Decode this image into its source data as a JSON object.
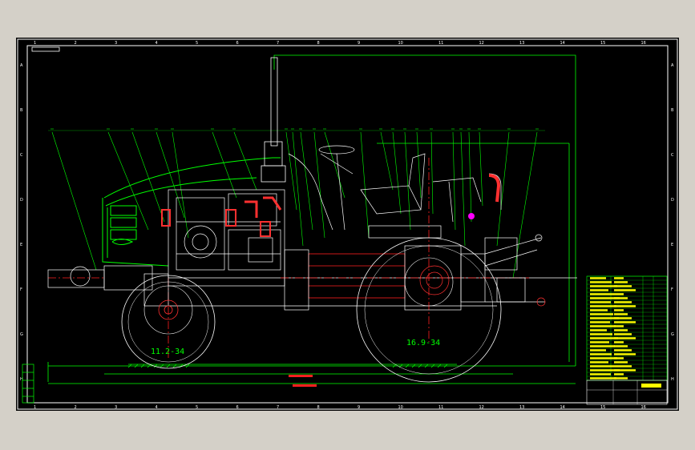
{
  "drawing": {
    "title": "tractor CAD assembly drawing",
    "colors": {
      "background": "#000000",
      "frame": "#ffffff",
      "outline": "#00ff00",
      "part_lines": "#ffffff",
      "red_hidden": "#ff0000",
      "accent_magenta": "#ff00ff",
      "title_yellow": "#ffff00"
    }
  },
  "tires": {
    "front_label": "11.2-34",
    "rear_label": "16.9-34"
  },
  "border": {
    "column_numbers": [
      "1",
      "2",
      "3",
      "4",
      "5",
      "6",
      "7",
      "8",
      "9",
      "10",
      "11",
      "12",
      "13",
      "14",
      "15",
      "16"
    ],
    "row_letters": [
      "A",
      "B",
      "C",
      "D",
      "E",
      "F",
      "G",
      "H"
    ]
  }
}
